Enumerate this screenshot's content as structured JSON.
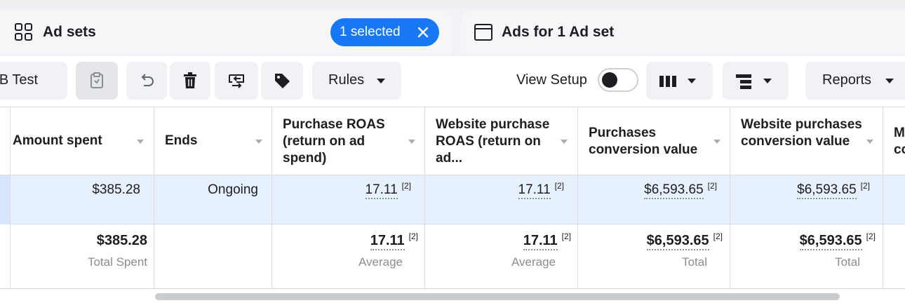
{
  "tabs": {
    "adsets_label": "Ad sets",
    "selected_pill": "1 selected",
    "ads_label": "Ads for 1 Ad set"
  },
  "toolbar": {
    "ab_test_label": "A/B Test",
    "rules_label": "Rules",
    "view_setup_label": "View Setup",
    "view_setup_on": false,
    "reports_label": "Reports"
  },
  "table": {
    "columns": [
      {
        "label": "Amount spent"
      },
      {
        "label": "Ends"
      },
      {
        "label": "Purchase ROAS (return on ad spend)"
      },
      {
        "label": "Website purchase ROAS (return on ad..."
      },
      {
        "label": "Purchases conversion value"
      },
      {
        "label": "Website purchases conversion value"
      },
      {
        "label": "M co"
      }
    ],
    "row": {
      "amount_spent": "$385.28",
      "ends": "Ongoing",
      "purchase_roas": "17.11",
      "website_purchase_roas": "17.11",
      "purchases_conversion_value": "$6,593.65",
      "website_purchases_conversion_value": "$6,593.65",
      "footnote": "[2]"
    },
    "totals": {
      "amount_spent": "$385.28",
      "amount_spent_caption": "Total Spent",
      "purchase_roas": "17.11",
      "purchase_roas_caption": "Average",
      "website_purchase_roas": "17.11",
      "website_purchase_roas_caption": "Average",
      "purchases_conversion_value": "$6,593.65",
      "purchases_conversion_value_caption": "Total",
      "website_purchases_conversion_value": "$6,593.65",
      "website_purchases_conversion_value_caption": "Total",
      "footnote": "[2]"
    }
  },
  "colors": {
    "accent": "#1877f2",
    "selected_row": "#e7f0fd"
  }
}
